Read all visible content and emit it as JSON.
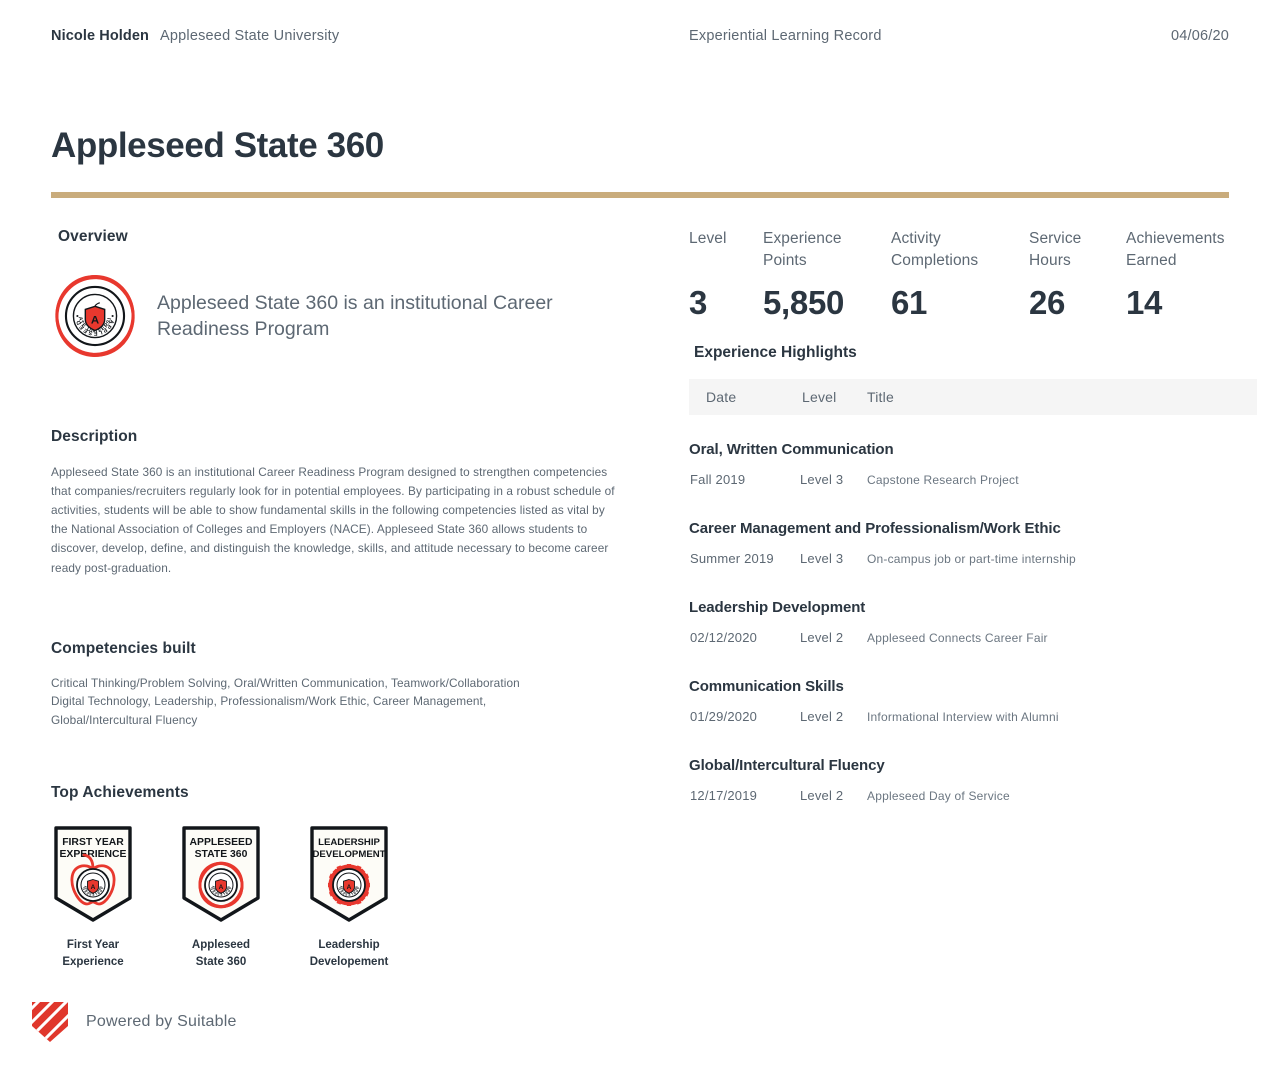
{
  "header": {
    "student_name": "Nicole Holden",
    "school_name": "Appleseed State University",
    "document_type": "Experiential Learning Record",
    "date": "04/06/20"
  },
  "title": "Appleseed State 360",
  "accent_colors": {
    "gold_rule": "#c9ac7c",
    "brand_red": "#e8382e",
    "text_dark": "#2b3641",
    "text_muted": "#5d6873",
    "table_header_bg": "#f5f5f5"
  },
  "overview": {
    "heading": "Overview",
    "logo_icon": "appleseed-university-seal-icon",
    "statement": "Appleseed State 360 is an institutional Career Readiness Program"
  },
  "description": {
    "heading": "Description",
    "body": "Appleseed State 360 is an institutional Career Readiness Program designed to strengthen competencies that companies/recruiters regularly look for in potential employees. By participating in a robust schedule of activities, students will be able to show fundamental skills in the following competencies listed as vital by the National Association of Colleges and Employers (NACE). Appleseed State 360 allows students to discover, develop, define, and distinguish the knowledge, skills, and attitude necessary to become career ready post-graduation."
  },
  "competencies": {
    "heading": "Competencies built",
    "body": "Critical Thinking/Problem Solving, Oral/Written Communication, Teamwork/Collaboration\nDigital Technology, Leadership, Professionalism/Work Ethic, Career Management,\nGlobal/Intercultural Fluency"
  },
  "top_achievements": {
    "heading": "Top Achievements",
    "badges": [
      {
        "icon": "first-year-experience-badge-icon",
        "badge_line1": "FIRST YEAR",
        "badge_line2": "EXPERIENCE",
        "caption": "First Year\nExperience"
      },
      {
        "icon": "appleseed-state-360-badge-icon",
        "badge_line1": "APPLESEED",
        "badge_line2": "STATE 360",
        "caption": "Appleseed\nState 360"
      },
      {
        "icon": "leadership-development-badge-icon",
        "badge_line1": "LEADERSHIP",
        "badge_line2": "DEVELOPMENT",
        "caption": "Leadership\nDevelopement"
      }
    ]
  },
  "stats": [
    {
      "label": "Level",
      "value": "3"
    },
    {
      "label": "Experience\nPoints",
      "value": "5,850"
    },
    {
      "label": "Activity\nCompletions",
      "value": "61"
    },
    {
      "label": "Service\nHours",
      "value": "26"
    },
    {
      "label": "Achievements\nEarned",
      "value": "14"
    }
  ],
  "experience_highlights": {
    "heading": "Experience Highlights",
    "columns": {
      "date": "Date",
      "level": "Level",
      "title": "Title"
    },
    "groups": [
      {
        "name": "Oral, Written Communication",
        "rows": [
          {
            "date": "Fall 2019",
            "level": "Level 3",
            "title": "Capstone Research Project"
          }
        ]
      },
      {
        "name": "Career Management and Professionalism/Work Ethic",
        "rows": [
          {
            "date": "Summer 2019",
            "level": "Level 3",
            "title": "On-campus job or part-time internship"
          }
        ]
      },
      {
        "name": "Leadership Development",
        "rows": [
          {
            "date": "02/12/2020",
            "level": "Level 2",
            "title": "Appleseed Connects Career Fair"
          }
        ]
      },
      {
        "name": "Communication Skills",
        "rows": [
          {
            "date": "01/29/2020",
            "level": "Level 2",
            "title": "Informational Interview with Alumni"
          }
        ]
      },
      {
        "name": "Global/Intercultural Fluency",
        "rows": [
          {
            "date": "12/17/2019",
            "level": "Level 2",
            "title": "Appleseed Day of Service"
          }
        ]
      }
    ]
  },
  "footer": {
    "logo_icon": "suitable-shield-icon",
    "text": "Powered by Suitable"
  }
}
